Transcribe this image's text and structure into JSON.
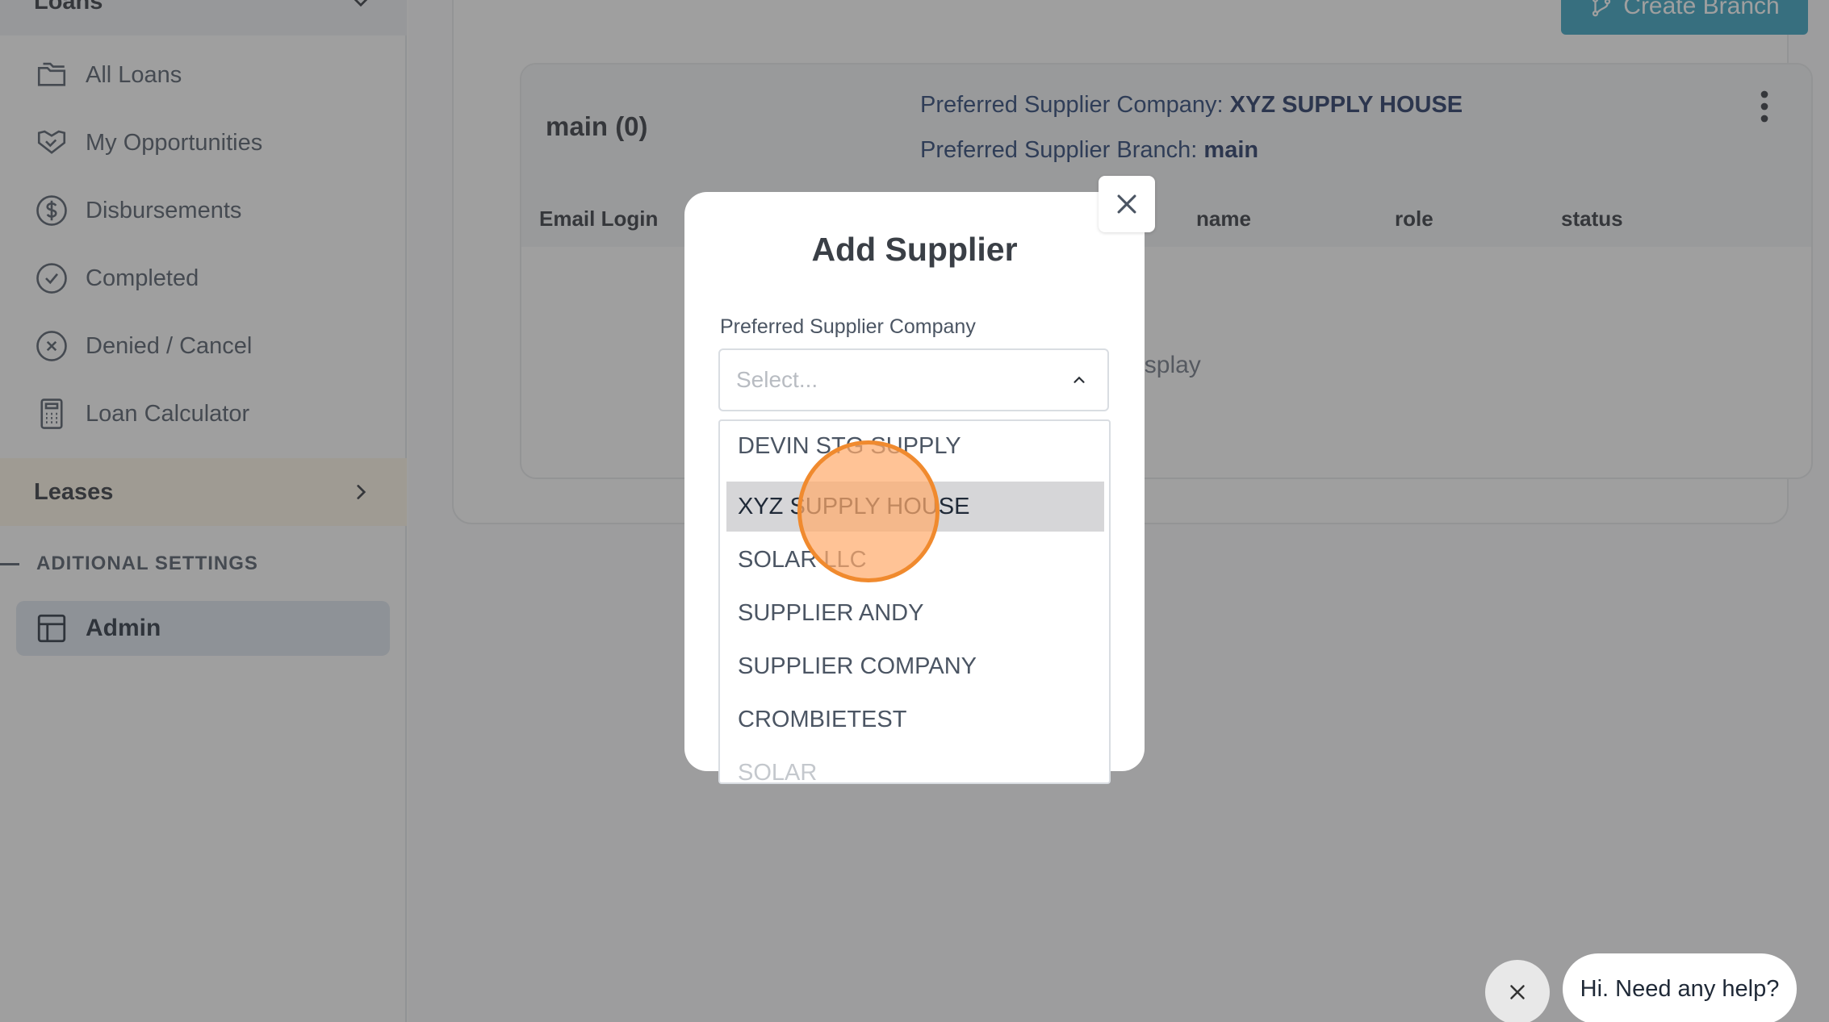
{
  "sidebar": {
    "loans_header": "Loans",
    "items": [
      {
        "label": "All Loans",
        "icon": "folders-icon"
      },
      {
        "label": "My Opportunities",
        "icon": "handshake-icon"
      },
      {
        "label": "Disbursements",
        "icon": "dollar-circle-icon"
      },
      {
        "label": "Completed",
        "icon": "check-circle-icon"
      },
      {
        "label": "Denied / Cancel",
        "icon": "x-circle-icon"
      },
      {
        "label": "Loan Calculator",
        "icon": "calculator-icon"
      }
    ],
    "leases_header": "Leases",
    "settings_label": "ADITIONAL SETTINGS",
    "admin_label": "Admin"
  },
  "main": {
    "create_branch_label": "Create Branch",
    "branch": {
      "name": "main (0)",
      "pref_company_label": "Preferred Supplier Company: ",
      "pref_company_value": "XYZ SUPPLY HOUSE",
      "pref_branch_label": "Preferred Supplier Branch: ",
      "pref_branch_value": "main",
      "columns": [
        "Email Login",
        "name",
        "role",
        "status"
      ],
      "empty_message": "No records to display"
    }
  },
  "modal": {
    "title": "Add Supplier",
    "field_label": "Preferred Supplier Company",
    "select_placeholder": "Select...",
    "options": [
      "DEVIN STG SUPPLY",
      "XYZ SUPPLY HOUSE",
      "SOLAR LLC",
      "SUPPLIER ANDY",
      "SUPPLIER COMPANY",
      "CROMBIETEST",
      "SOLAR"
    ],
    "highlighted_option": "XYZ SUPPLY HOUSE"
  },
  "chat": {
    "bubble_text": "Hi. Need any help?"
  },
  "colors": {
    "accent": "#2e9fbf",
    "click_indicator": "#f08a2e",
    "overlay": "rgba(64,64,64,0.5)"
  }
}
